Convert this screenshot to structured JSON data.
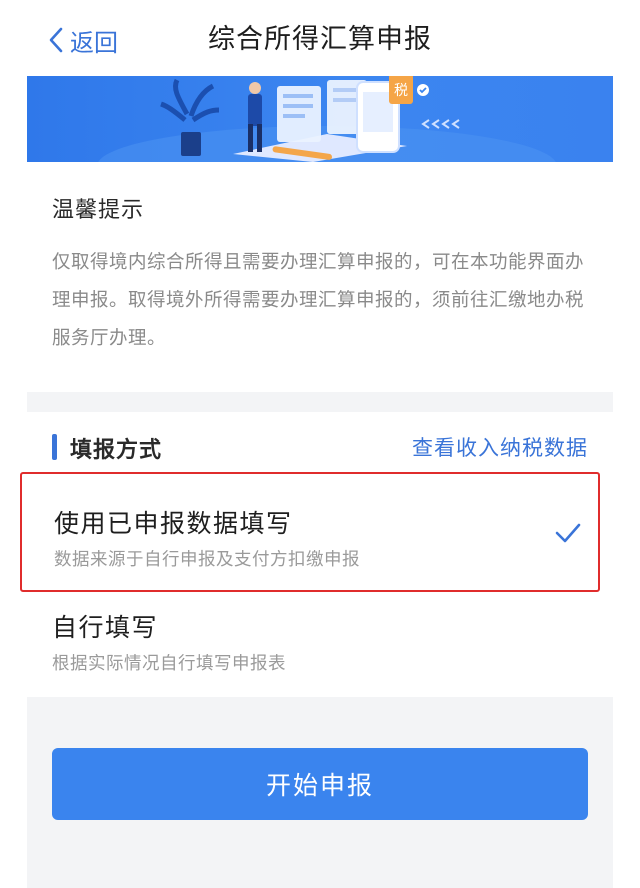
{
  "nav": {
    "back_label": "返回",
    "title": "综合所得汇算申报"
  },
  "banner": {
    "badge_text": "税"
  },
  "tips": {
    "title": "温馨提示",
    "body": "仅取得境内综合所得且需要办理汇算申报的，可在本功能界面办理申报。取得境外所得需要办理汇算申报的，须前往汇缴地办税服务厅办理。"
  },
  "method": {
    "title": "填报方式",
    "link": "查看收入纳税数据",
    "options": [
      {
        "title": "使用已申报数据填写",
        "subtitle": "数据来源于自行申报及支付方扣缴申报",
        "selected": true
      },
      {
        "title": "自行填写",
        "subtitle": "根据实际情况自行填写申报表",
        "selected": false
      }
    ]
  },
  "cta": {
    "label": "开始申报"
  },
  "colors": {
    "accent": "#3a74d8",
    "button": "#3a84ee",
    "highlight": "#e02c2c"
  }
}
